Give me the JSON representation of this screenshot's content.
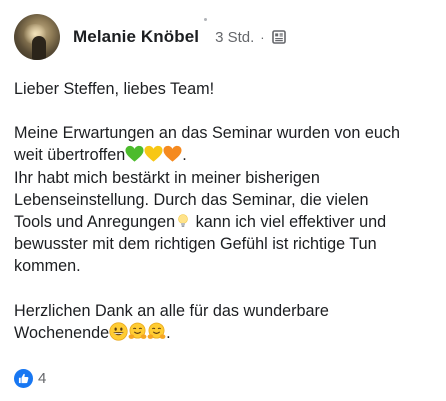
{
  "post": {
    "author": {
      "name": "Melanie Knöbel",
      "time": "3 Std.",
      "separator": "·",
      "privacy_icon": "group-icon"
    },
    "lines": {
      "greeting": "Lieber Steffen, liebes Team!",
      "p1_a": "Meine Erwartungen an das Seminar wurden von euch",
      "p1_b": "weit übertroffen",
      "p1_b_end": ".",
      "p1_c": "Ihr habt mich bestärkt in meiner bisherigen",
      "p1_d": "Lebenseinstellung. Durch das Seminar, die vielen",
      "p1_e_start": "Tools und Anregungen",
      "p1_e_end": " kann ich viel effektiver und",
      "p1_f": "bewusster mit dem richtigen Gefühl ist richtige Tun",
      "p1_g": "kommen.",
      "p2_a": "Herzlichen Dank an alle für das wunderbare",
      "p2_b": "Wochenende",
      "p2_b_end": "."
    },
    "emojis": {
      "after_uebertroffen": [
        "green-heart-icon",
        "yellow-heart-icon",
        "orange-heart-icon"
      ],
      "after_anregungen": [
        "light-bulb-icon"
      ],
      "after_wochenende": [
        "grinning-face-icon",
        "hugging-face-icon",
        "hugging-face-icon"
      ]
    },
    "reactions": {
      "type": "like-icon",
      "count": "4"
    },
    "colors": {
      "like_blue": "#1877f2",
      "meta_gray": "#65676b",
      "text": "#1c1e21"
    }
  }
}
